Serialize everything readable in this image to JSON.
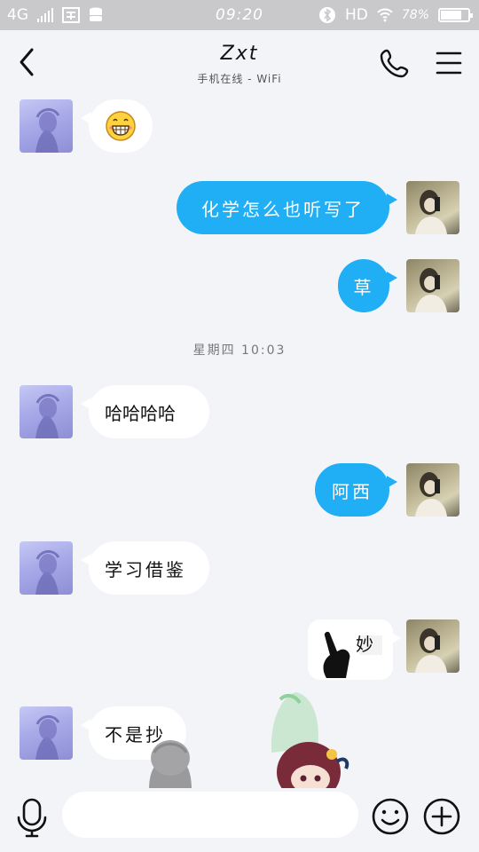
{
  "status_bar": {
    "network": "4G",
    "time": "09:20",
    "hd": "HD",
    "battery": "78%",
    "battery_level": 0.78
  },
  "header": {
    "title": "Zxt",
    "subtitle": "手机在线 - WiFi"
  },
  "messages": [
    {
      "sender": "friend",
      "type": "emoji",
      "text": ""
    },
    {
      "sender": "me",
      "type": "text",
      "text": "化学怎么也听写了"
    },
    {
      "sender": "me",
      "type": "text",
      "text": "草"
    },
    {
      "sender": "friend",
      "type": "text",
      "text": "哈哈哈哈"
    },
    {
      "sender": "me",
      "type": "text",
      "text": "阿西"
    },
    {
      "sender": "friend",
      "type": "text",
      "text": "学习借鉴"
    },
    {
      "sender": "me",
      "type": "sticker",
      "text": "妙"
    },
    {
      "sender": "friend",
      "type": "text",
      "text": "不是抄"
    }
  ],
  "timestamp": "星期四 10:03",
  "input": {
    "placeholder": "",
    "value": ""
  },
  "colors": {
    "outgoing_bubble": "#20aef5",
    "incoming_bubble": "#ffffff",
    "background": "#f3f4f8",
    "status_bar": "#c9c9cc"
  },
  "icons": [
    "back-icon",
    "phone-icon",
    "menu-icon",
    "mic-icon",
    "emoji-icon",
    "plus-icon"
  ]
}
